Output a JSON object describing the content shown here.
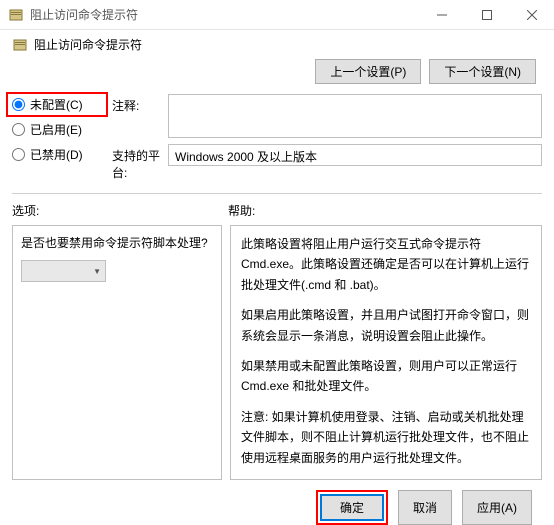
{
  "window": {
    "title": "阻止访问命令提示符"
  },
  "header": {
    "title": "阻止访问命令提示符"
  },
  "nav": {
    "prev": "上一个设置(P)",
    "next": "下一个设置(N)"
  },
  "radios": {
    "not_configured": "未配置(C)",
    "enabled": "已启用(E)",
    "disabled": "已禁用(D)"
  },
  "fields": {
    "comment_label": "注释:",
    "comment_value": "",
    "platform_label": "支持的平台:",
    "platform_value": "Windows 2000 及以上版本"
  },
  "labels": {
    "options": "选项:",
    "help": "帮助:"
  },
  "options": {
    "script_question": "是否也要禁用命令提示符脚本处理?",
    "dropdown_value": ""
  },
  "help": {
    "p1": "此策略设置将阻止用户运行交互式命令提示符 Cmd.exe。此策略设置还确定是否可以在计算机上运行批处理文件(.cmd 和 .bat)。",
    "p2": "如果启用此策略设置，并且用户试图打开命令窗口，则系统会显示一条消息，说明设置会阻止此操作。",
    "p3": "如果禁用或未配置此策略设置，则用户可以正常运行 Cmd.exe 和批处理文件。",
    "p4": "注意: 如果计算机使用登录、注销、启动或关机批处理文件脚本，则不阻止计算机运行批处理文件，也不阻止使用远程桌面服务的用户运行批处理文件。"
  },
  "buttons": {
    "ok": "确定",
    "cancel": "取消",
    "apply": "应用(A)"
  }
}
